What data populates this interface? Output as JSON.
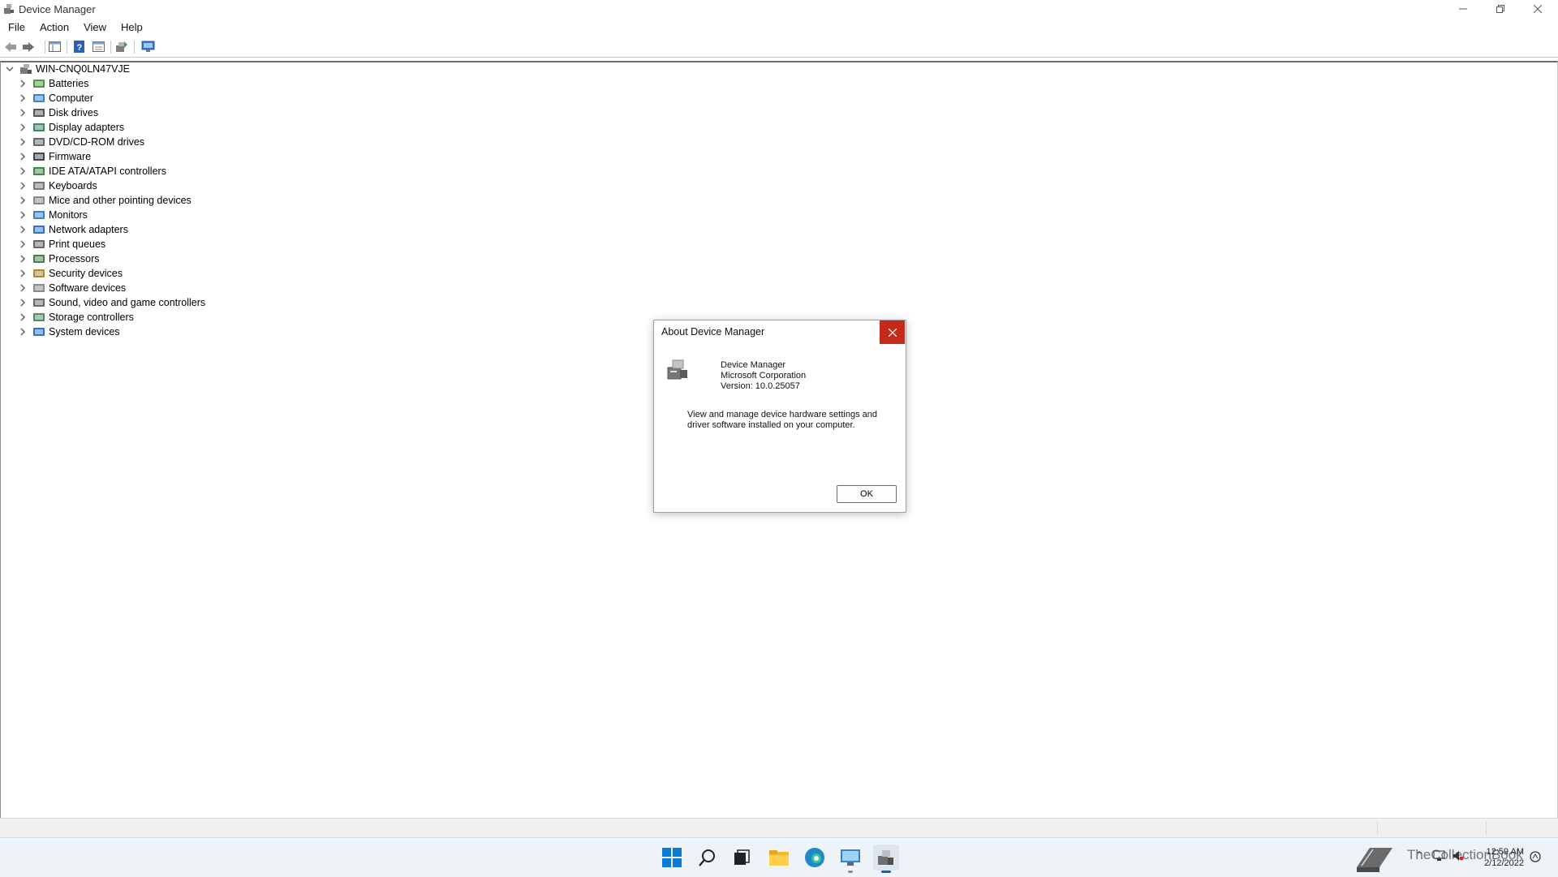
{
  "window": {
    "title": "Device Manager"
  },
  "menu": [
    "File",
    "Action",
    "View",
    "Help"
  ],
  "tree": {
    "root": "WIN-CNQ0LN47VJE",
    "items": [
      {
        "label": "Batteries",
        "icon": "battery-icon"
      },
      {
        "label": "Computer",
        "icon": "computer-icon"
      },
      {
        "label": "Disk drives",
        "icon": "disk-drive-icon"
      },
      {
        "label": "Display adapters",
        "icon": "display-adapter-icon"
      },
      {
        "label": "DVD/CD-ROM drives",
        "icon": "dvd-drive-icon"
      },
      {
        "label": "Firmware",
        "icon": "firmware-icon"
      },
      {
        "label": "IDE ATA/ATAPI controllers",
        "icon": "ide-controller-icon"
      },
      {
        "label": "Keyboards",
        "icon": "keyboard-icon"
      },
      {
        "label": "Mice and other pointing devices",
        "icon": "mouse-icon"
      },
      {
        "label": "Monitors",
        "icon": "monitor-icon"
      },
      {
        "label": "Network adapters",
        "icon": "network-adapter-icon"
      },
      {
        "label": "Print queues",
        "icon": "printer-icon"
      },
      {
        "label": "Processors",
        "icon": "processor-icon"
      },
      {
        "label": "Security devices",
        "icon": "security-device-icon"
      },
      {
        "label": "Software devices",
        "icon": "software-device-icon"
      },
      {
        "label": "Sound, video and game controllers",
        "icon": "sound-icon"
      },
      {
        "label": "Storage controllers",
        "icon": "storage-controller-icon"
      },
      {
        "label": "System devices",
        "icon": "system-device-icon"
      }
    ]
  },
  "dialog": {
    "title": "About Device Manager",
    "app_name": "Device Manager",
    "company": "Microsoft Corporation",
    "version": "Version: 10.0.25057",
    "desc_line1": "View and manage device hardware settings and",
    "desc_line2": "driver software installed on your computer.",
    "ok_label": "OK"
  },
  "taskbar": {
    "time": "12:59 AM",
    "date": "2/12/2022",
    "watermark": "TheCollectionBook"
  },
  "colors": {
    "close_red": "#c42b1c",
    "taskbar_bg": "#eef3f8"
  }
}
